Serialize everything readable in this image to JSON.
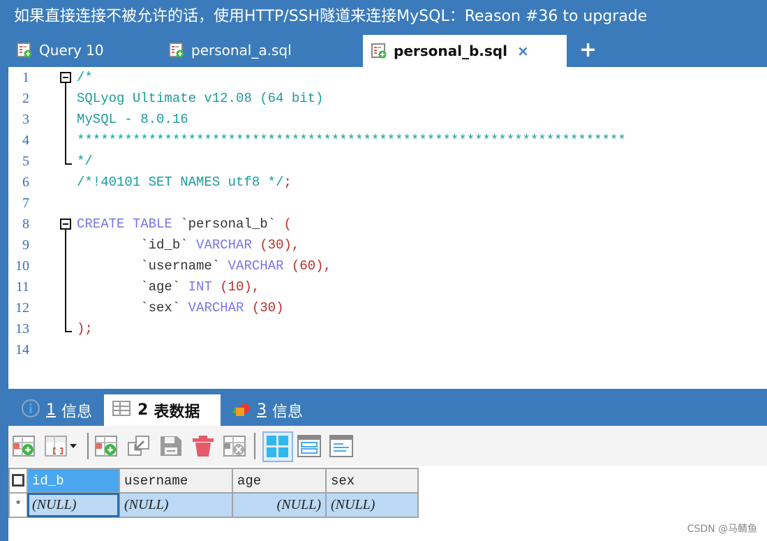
{
  "window": {
    "title": "如果直接连接不被允许的话，使用HTTP/SSH隧道来连接MySQL：Reason #36 to upgrade"
  },
  "tabs": [
    {
      "label": "Query 10",
      "active": false
    },
    {
      "label": "personal_a.sql",
      "active": false
    },
    {
      "label": "personal_b.sql",
      "active": true,
      "close": "×"
    }
  ],
  "tab_add_label": "+",
  "editor": {
    "line_numbers": [
      "1",
      "2",
      "3",
      "4",
      "5",
      "6",
      "7",
      "8",
      "9",
      "10",
      "11",
      "12",
      "13",
      "14"
    ],
    "lines": [
      [
        {
          "t": "/*",
          "c": "comment"
        }
      ],
      [
        {
          "t": "SQLyog Ultimate v12.08 (64 bit)",
          "c": "comment"
        }
      ],
      [
        {
          "t": "MySQL - 8.0.16",
          "c": "comment"
        }
      ],
      [
        {
          "t": "*********************************************************************",
          "c": "comment"
        }
      ],
      [
        {
          "t": "*/",
          "c": "comment"
        }
      ],
      [
        {
          "t": "/*!40101 SET NAMES utf8 */",
          "c": "comment"
        },
        {
          "t": ";",
          "c": "punc"
        }
      ],
      [],
      [
        {
          "t": "CREATE TABLE ",
          "c": "kw"
        },
        {
          "t": "`personal_b`",
          "c": "str"
        },
        {
          "t": " (",
          "c": "punc"
        }
      ],
      [
        {
          "t": "        ",
          "c": "str"
        },
        {
          "t": "`id_b`",
          "c": "str"
        },
        {
          "t": " VARCHAR ",
          "c": "kw"
        },
        {
          "t": "(30),",
          "c": "punc"
        }
      ],
      [
        {
          "t": "        ",
          "c": "str"
        },
        {
          "t": "`username`",
          "c": "str"
        },
        {
          "t": " VARCHAR ",
          "c": "kw"
        },
        {
          "t": "(60),",
          "c": "punc"
        }
      ],
      [
        {
          "t": "        ",
          "c": "str"
        },
        {
          "t": "`age`",
          "c": "str"
        },
        {
          "t": " INT ",
          "c": "kw"
        },
        {
          "t": "(10),",
          "c": "punc"
        }
      ],
      [
        {
          "t": "        ",
          "c": "str"
        },
        {
          "t": "`sex`",
          "c": "str"
        },
        {
          "t": " VARCHAR ",
          "c": "kw"
        },
        {
          "t": "(30)",
          "c": "punc"
        }
      ],
      [
        {
          "t": ");",
          "c": "punc"
        }
      ],
      []
    ]
  },
  "result_tabs": [
    {
      "num": "1",
      "label": "信息",
      "icon": "info-icon",
      "active": false
    },
    {
      "num": "2",
      "label": "表数据",
      "icon": "table-grid-icon",
      "active": true
    },
    {
      "num": "3",
      "label": "信息",
      "icon": "shapes-icon",
      "active": false
    }
  ],
  "toolbar": {
    "buttons": [
      {
        "name": "insert-row-button",
        "icon": "insert-row-icon"
      },
      {
        "name": "set-null-dropdown-button",
        "icon": "set-null-icon"
      },
      {
        "name": "duplicate-row-button",
        "icon": "duplicate-row-icon"
      },
      {
        "name": "revert-button",
        "icon": "revert-icon"
      },
      {
        "name": "save-button",
        "icon": "save-icon"
      },
      {
        "name": "delete-button",
        "icon": "trash-icon"
      },
      {
        "name": "cancel-changes-button",
        "icon": "cancel-icon"
      },
      {
        "name": "grid-view-button",
        "icon": "grid-view-icon",
        "active": true
      },
      {
        "name": "form-view-button",
        "icon": "form-view-icon"
      },
      {
        "name": "text-view-button",
        "icon": "text-view-icon"
      }
    ]
  },
  "grid": {
    "columns": [
      "id_b",
      "username",
      "age",
      "sex"
    ],
    "selected_column": "id_b",
    "rows": [
      {
        "marker": "*",
        "cells": [
          "(NULL)",
          "(NULL)",
          "(NULL)",
          "(NULL)"
        ]
      }
    ]
  },
  "watermark": "CSDN @马鲭鱼",
  "colors": {
    "accent": "#3b7bbb",
    "comment": "#1a9c9c",
    "keyword": "#7a74f0",
    "punctuation": "#b8302a",
    "selected_header": "#4aa7f0",
    "row_selection": "#bcd9f5",
    "delete_red": "#e85a6a"
  }
}
